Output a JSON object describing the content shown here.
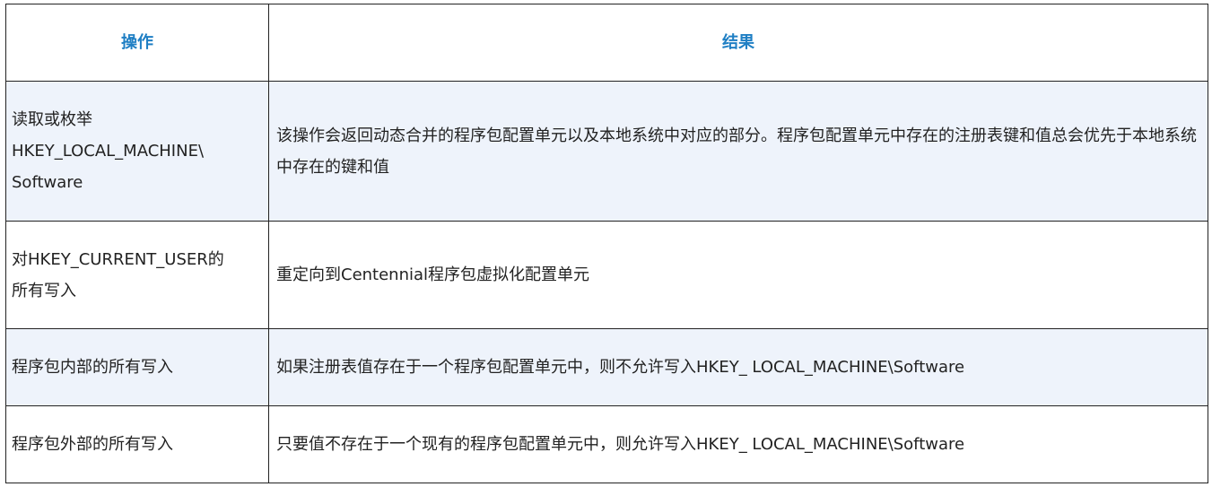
{
  "table": {
    "headers": [
      "操作",
      "结果"
    ],
    "rows": [
      {
        "operation_lines": [
          "读取或枚举",
          "HKEY_LOCAL_MACHINE\\",
          "Software"
        ],
        "result": "该操作会返回动态合并的程序包配置单元以及本地系统中对应的部分。程序包配置单元中存在的注册表键和值总会优先于本地系统中存在的键和值"
      },
      {
        "operation_lines": [
          "对HKEY_CURRENT_USER的",
          "所有写入"
        ],
        "result": "重定向到Centennial程序包虚拟化配置单元"
      },
      {
        "operation_lines": [
          "程序包内部的所有写入"
        ],
        "result": "如果注册表值存在于一个程序包配置单元中，则不允许写入HKEY_ LOCAL_MACHINE\\Software"
      },
      {
        "operation_lines": [
          "程序包外部的所有写入"
        ],
        "result": "只要值不存在于一个现有的程序包配置单元中，则允许写入HKEY_ LOCAL_MACHINE\\Software"
      }
    ]
  },
  "colors": {
    "header_text": "#1f7fc4",
    "alt_row_bg": "#eef3fb",
    "border": "#222222"
  }
}
